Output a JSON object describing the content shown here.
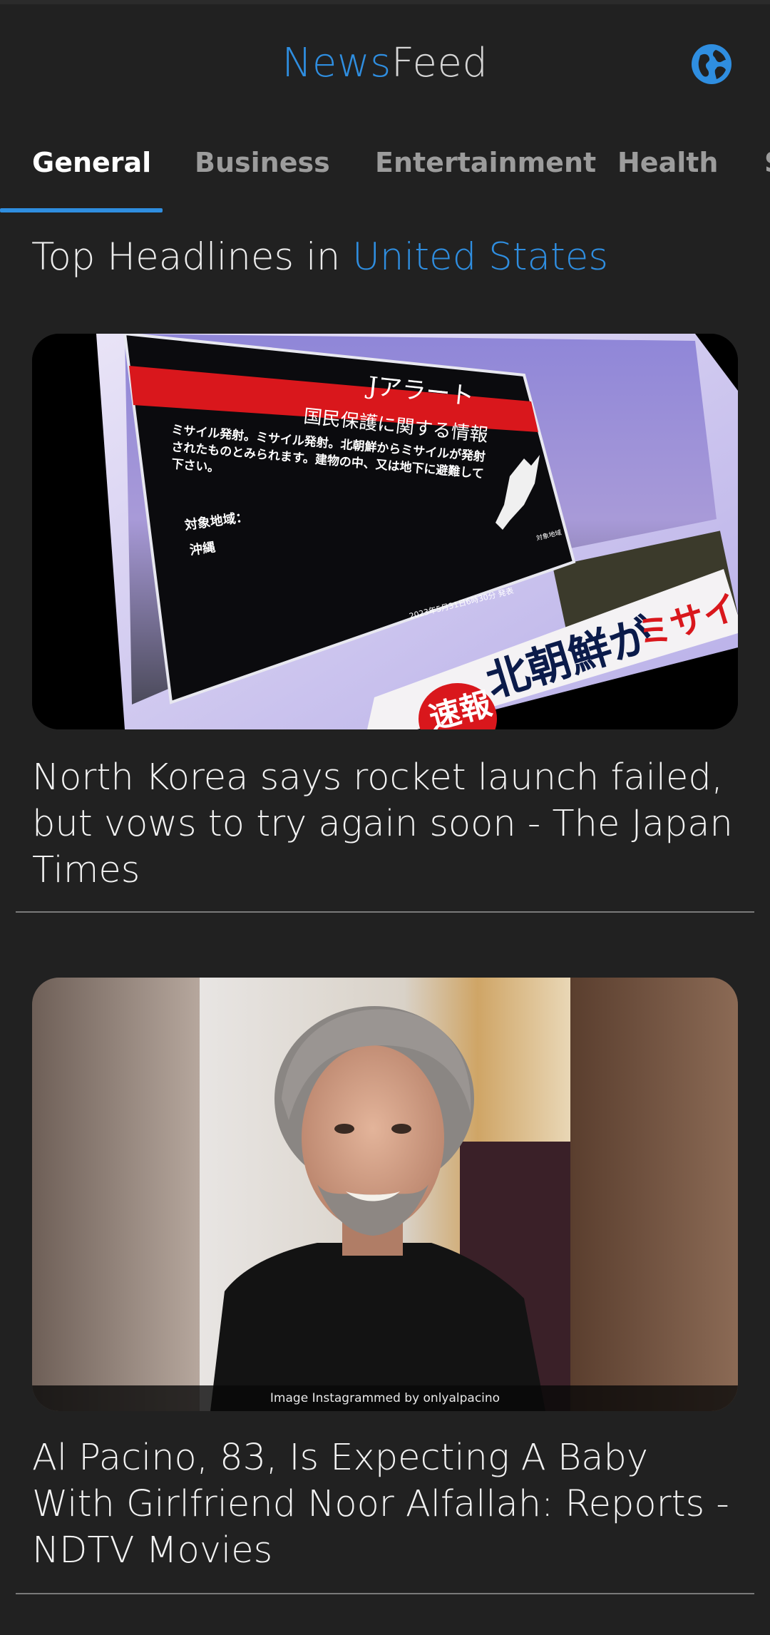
{
  "app": {
    "title_part1": "News",
    "title_part2": "Feed"
  },
  "tabs": [
    {
      "label": "General"
    },
    {
      "label": "Business"
    },
    {
      "label": "Entertainment"
    },
    {
      "label": "Health"
    },
    {
      "label": "S"
    }
  ],
  "section": {
    "prefix": "Top Headlines in ",
    "country": "United States"
  },
  "articles": [
    {
      "title": "North Korea says rocket launch failed, but vows to try again soon - The Japan Times",
      "image": {
        "tv_header": "Jアラート",
        "tv_banner": "国民保護に関する情報",
        "tv_body_1": "ミサイル発射。ミサイル発射。北朝鮮からミサイルが発射",
        "tv_body_2": "されたものとみられます。建物の中、又は地下に避難して",
        "tv_body_3": "下さい。",
        "tv_area_label": "対象地域：",
        "tv_area": "沖縄",
        "tv_timestamp": "2023年5月31日6時30分 発表",
        "tv_map_label": "対象地域",
        "ticker_badge": "速報",
        "ticker_text_1": "北朝鮮が",
        "ticker_text_2": "ミサイル発射"
      }
    },
    {
      "title": "Al Pacino, 83, Is Expecting A Baby With Girlfriend Noor Alfallah: Reports - NDTV Movies",
      "image": {
        "caption": "Image Instagrammed by onlyalpacino"
      }
    }
  ],
  "colors": {
    "background": "#212121",
    "accent": "#2f8ee0",
    "divider": "#7a7a7a"
  },
  "icons": {
    "language": "globe-icon"
  }
}
